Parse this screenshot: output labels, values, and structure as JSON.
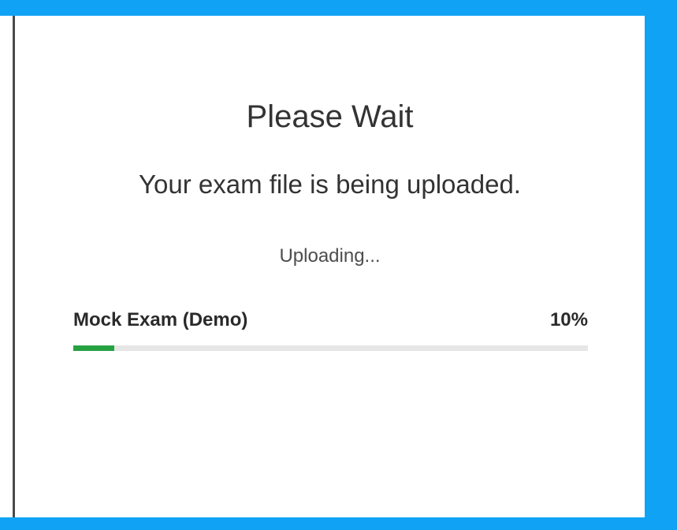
{
  "dialog": {
    "title": "Please Wait",
    "message": "Your exam file is being uploaded.",
    "status": "Uploading..."
  },
  "upload": {
    "file_name": "Mock Exam (Demo)",
    "percent_label": "10%",
    "progress": 0.08
  },
  "colors": {
    "frame": "#10a3f5",
    "progress_fill": "#27a243",
    "progress_track": "#e6e6e6"
  }
}
